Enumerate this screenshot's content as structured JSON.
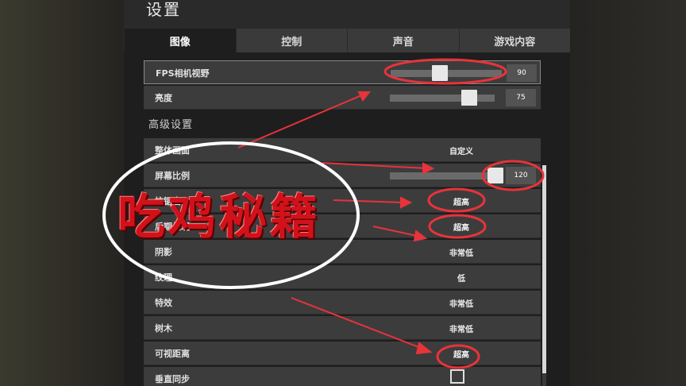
{
  "window": {
    "title": "设置"
  },
  "tabs": [
    {
      "label": "图像",
      "active": true
    },
    {
      "label": "控制",
      "active": false
    },
    {
      "label": "声音",
      "active": false
    },
    {
      "label": "游戏内容",
      "active": false
    }
  ],
  "settings": {
    "fps_camera_fov": {
      "label": "FPS相机视野",
      "value": "90",
      "slider_fraction": 0.37
    },
    "brightness": {
      "label": "亮度",
      "value": "75",
      "slider_fraction": 0.75
    },
    "advanced_heading": "高级设置",
    "overall_quality": {
      "label": "整体画面",
      "value": "自定义"
    },
    "screen_scale": {
      "label": "屏幕比例",
      "value": "120",
      "slider_fraction": 1.0
    },
    "anti_aliasing": {
      "label": "抗锯齿",
      "value": "超高"
    },
    "post_processing": {
      "label": "后期处理",
      "value": "超高"
    },
    "shadows": {
      "label": "阴影",
      "value": "非常低"
    },
    "textures": {
      "label": "纹理",
      "value": "低"
    },
    "effects": {
      "label": "特效",
      "value": "非常低"
    },
    "foliage": {
      "label": "树木",
      "value": "非常低"
    },
    "view_distance": {
      "label": "可视距离",
      "value": "超高"
    },
    "vsync": {
      "label": "垂直同步",
      "checked": false
    }
  },
  "overlay": {
    "watermark": "吃鸡秘籍",
    "annotation_color": "#e8333a"
  },
  "colors": {
    "panel": "#1e1e1f",
    "row": "#3c3c3d",
    "tab_inactive": "#3a3a3b"
  }
}
